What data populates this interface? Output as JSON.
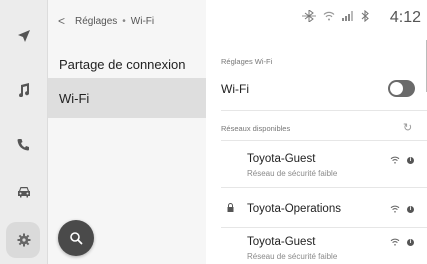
{
  "rail": {
    "items": [
      {
        "icon": "navigation-arrow-icon"
      },
      {
        "icon": "music-note-icon"
      },
      {
        "icon": "phone-icon"
      },
      {
        "icon": "car-icon"
      },
      {
        "icon": "settings-gear-icon",
        "active": true
      }
    ]
  },
  "breadcrumb": {
    "back": "<",
    "parent": "Réglages",
    "separator": "•",
    "current": "Wi-Fi"
  },
  "menu": {
    "items": [
      {
        "label": "Partage de connexion",
        "selected": false
      },
      {
        "label": "Wi-Fi",
        "selected": true
      }
    ]
  },
  "search": {
    "icon": "search-icon"
  },
  "status_bar": {
    "icons": [
      "bluetooth-connection-icon",
      "wifi-signal-icon",
      "cellular-signal-icon",
      "bluetooth-icon"
    ],
    "time": "4:12"
  },
  "wifi_settings": {
    "section_label": "Réglages Wi-Fi",
    "wifi_label": "Wi-Fi",
    "wifi_enabled": true
  },
  "networks": {
    "section_label": "Réseaux disponibles",
    "refresh_icon": "refresh-icon",
    "items": [
      {
        "name": "Toyota-Guest",
        "subtitle": "Réseau de sécurité faible",
        "locked": false
      },
      {
        "name": "Toyota-Operations",
        "subtitle": "",
        "locked": true
      },
      {
        "name": "Toyota-Guest",
        "subtitle": "Réseau de sécurité faible",
        "locked": false
      }
    ]
  }
}
